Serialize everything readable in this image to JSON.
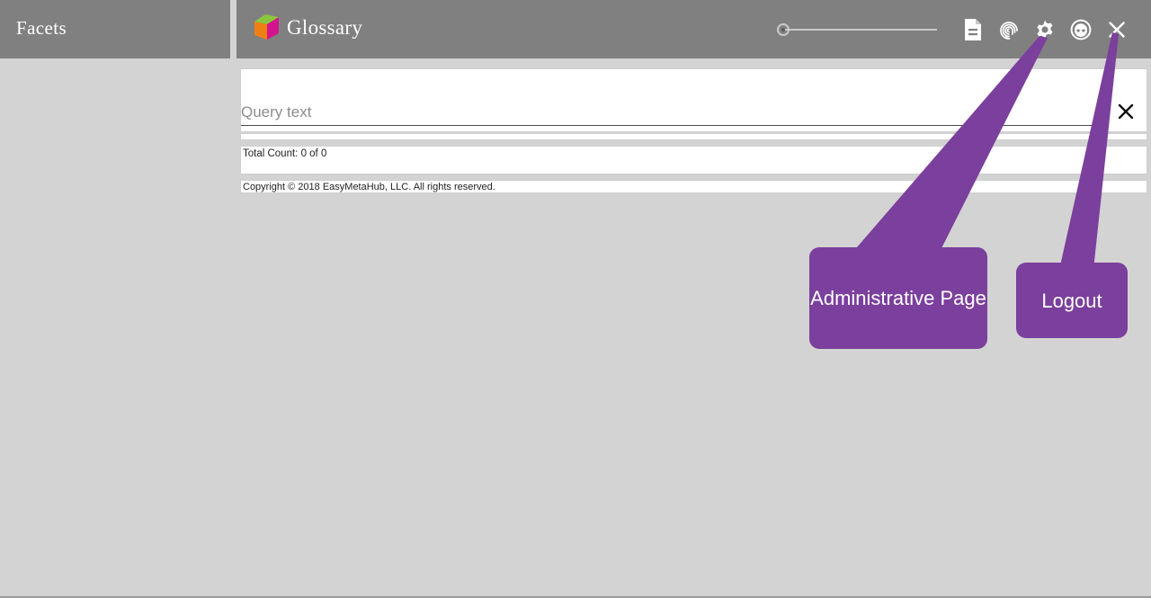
{
  "facets": {
    "title": "Facets"
  },
  "header": {
    "brand_title": "Glossary",
    "logo_icon": "cube-logo-icon",
    "logo_colors": {
      "top": "#8CC63E",
      "left": "#F07F13",
      "right": "#D4148C"
    },
    "toolbar": {
      "slider": {
        "name": "zoom-slider",
        "value": 0,
        "min": 0,
        "max": 100
      },
      "icons": [
        {
          "name": "document-icon",
          "label": "Document"
        },
        {
          "name": "fingerprint-icon",
          "label": "Fingerprint"
        },
        {
          "name": "gear-icon",
          "label": "Settings"
        },
        {
          "name": "face-icon",
          "label": "Profile"
        },
        {
          "name": "close-icon",
          "label": "Close"
        }
      ]
    }
  },
  "search": {
    "placeholder": "Query text",
    "value": "",
    "clear_icon": "close-icon"
  },
  "status": {
    "count_text": "Total Count: 0 of 0"
  },
  "footer": {
    "copyright": "Copyright © 2018 EasyMetaHub, LLC. All rights reserved."
  },
  "annotations": {
    "color": "#7B3F9D",
    "items": [
      {
        "name": "annotation-administrative-page",
        "label": "Administrative Page"
      },
      {
        "name": "annotation-logout",
        "label": "Logout"
      }
    ]
  },
  "colors": {
    "header_grey": "#808080",
    "body_grey": "#d3d3d3",
    "panel_white": "#ffffff",
    "annotation_purple": "#7B3F9D"
  }
}
